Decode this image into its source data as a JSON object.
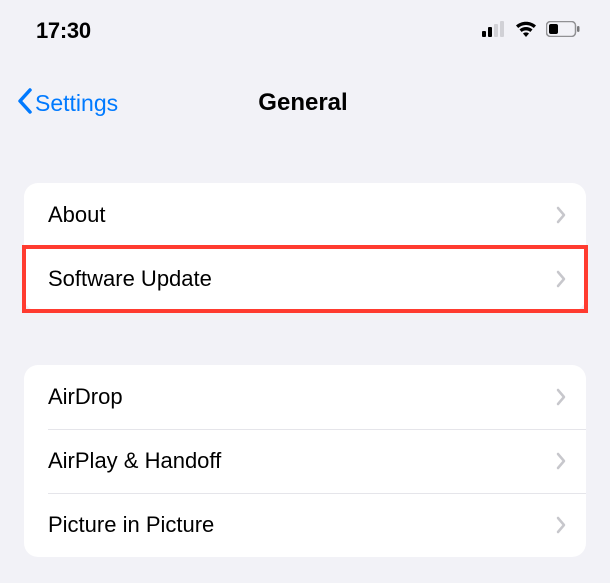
{
  "statusBar": {
    "time": "17:30"
  },
  "nav": {
    "backLabel": "Settings",
    "title": "General"
  },
  "sections": [
    {
      "rows": [
        {
          "label": "About"
        },
        {
          "label": "Software Update"
        }
      ]
    },
    {
      "rows": [
        {
          "label": "AirDrop"
        },
        {
          "label": "AirPlay & Handoff"
        },
        {
          "label": "Picture in Picture"
        }
      ]
    }
  ]
}
